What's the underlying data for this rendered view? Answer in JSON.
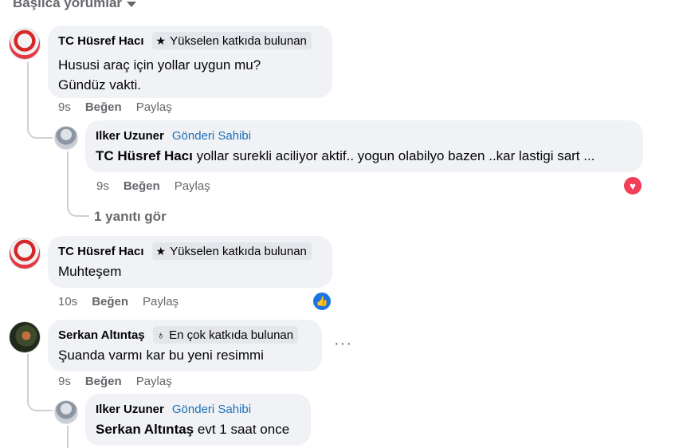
{
  "sort": {
    "label": "Başlıca yorumlar"
  },
  "comments": [
    {
      "author": "TC Hüsref Hacı",
      "badge": "Yükselen katkıda bulunan",
      "badge_icon": "star-icon",
      "lines": [
        "Hususi araç için yollar uygun mu?",
        "Gündüz vakti."
      ],
      "time": "9s",
      "like": "Beğen",
      "share": "Paylaş",
      "reply": {
        "author": "Ilker Uzuner",
        "role": "Gönderi Sahibi",
        "mention": "TC Hüsref Hacı",
        "text": " yollar surekli aciliyor aktif.. yogun olabilyo bazen ..kar lastigi sart ...",
        "time": "9s",
        "like": "Beğen",
        "share": "Paylaş",
        "reaction": "heart-reaction-icon"
      },
      "view_replies": "1 yanıtı gör"
    },
    {
      "author": "TC Hüsref Hacı",
      "badge": "Yükselen katkıda bulunan",
      "badge_icon": "star-icon",
      "text": "Muhteşem",
      "time": "10s",
      "like": "Beğen",
      "share": "Paylaş",
      "reaction": "like-reaction-icon"
    },
    {
      "author": "Serkan Altıntaş",
      "badge": "En çok katkıda bulunan",
      "badge_icon": "award-icon",
      "text": "Şuanda varmı kar bu yeni resimmi",
      "time": "9s",
      "like": "Beğen",
      "share": "Paylaş",
      "more": "···",
      "reply": {
        "author": "Ilker Uzuner",
        "role": "Gönderi Sahibi",
        "mention": "Serkan Altıntaş",
        "text": " evt 1 saat once"
      }
    }
  ],
  "colors": {
    "bubble": "#f0f2f5",
    "owner_label": "#1d6fb8",
    "heart": "#f33e58",
    "like": "#1b74e4"
  }
}
